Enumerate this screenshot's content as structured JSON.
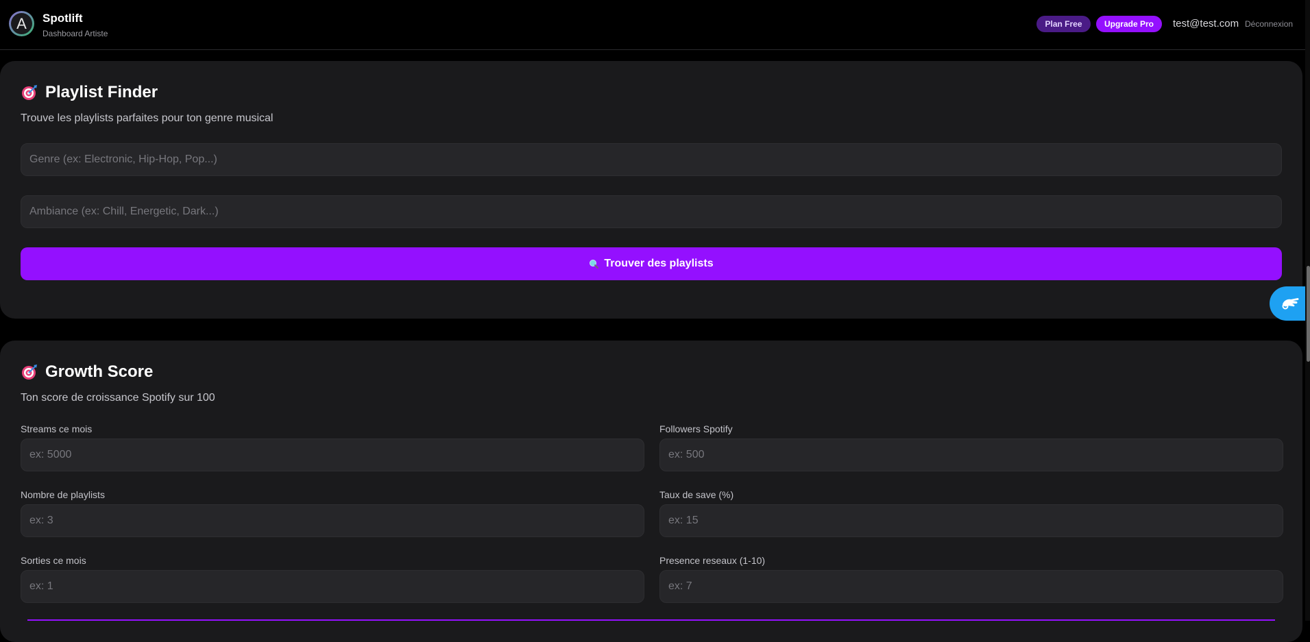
{
  "header": {
    "avatar_letter": "A",
    "brand": "Spotlift",
    "subtitle": "Dashboard Artiste",
    "plan_badge": "Plan Free",
    "upgrade_button": "Upgrade Pro",
    "user_email": "test@test.com",
    "logout": "Déconnexion"
  },
  "playlist_finder": {
    "title": "Playlist Finder",
    "subtitle": "Trouve les playlists parfaites pour ton genre musical",
    "genre_placeholder": "Genre (ex: Electronic, Hip-Hop, Pop...)",
    "ambiance_placeholder": "Ambiance (ex: Chill, Energetic, Dark...)",
    "search_button": "Trouver des playlists",
    "icon": "target-icon"
  },
  "growth_score": {
    "title": "Growth Score",
    "subtitle": "Ton score de croissance Spotify sur 100",
    "icon": "target-icon",
    "fields": [
      {
        "label": "Streams ce mois",
        "placeholder": "ex: 5000"
      },
      {
        "label": "Followers Spotify",
        "placeholder": "ex: 500"
      },
      {
        "label": "Nombre de playlists",
        "placeholder": "ex: 3"
      },
      {
        "label": "Taux de save (%)",
        "placeholder": "ex: 15"
      },
      {
        "label": "Sorties ce mois",
        "placeholder": "ex: 1"
      },
      {
        "label": "Presence reseaux (1-10)",
        "placeholder": "ex: 7"
      }
    ]
  },
  "colors": {
    "accent": "#9410ff",
    "plan_badge_bg": "#4a1b86",
    "card_bg": "#1a1a1c",
    "input_bg": "#262629",
    "helper_bg": "#1ea1f2"
  }
}
